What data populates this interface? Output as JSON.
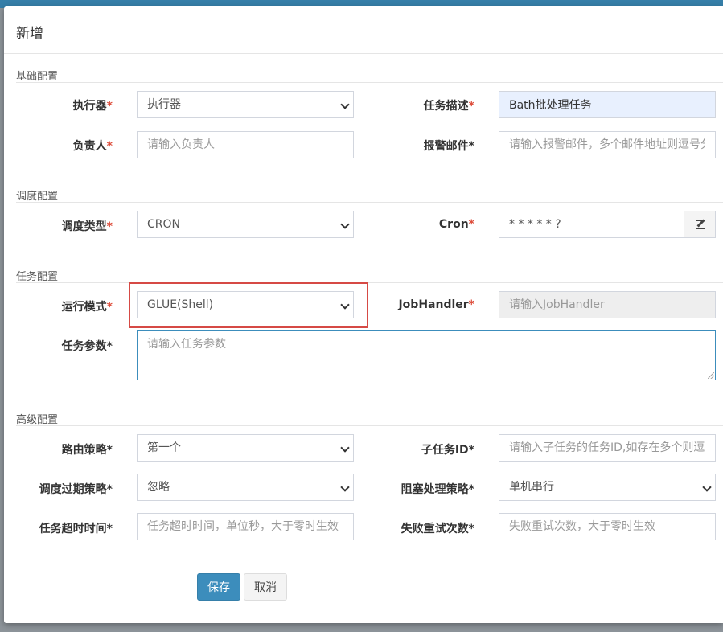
{
  "dialog": {
    "title": "新增"
  },
  "sections": {
    "basic": "基础配置",
    "schedule": "调度配置",
    "task": "任务配置",
    "advanced": "高级配置"
  },
  "required_mark": "*",
  "fields": {
    "executor": {
      "label": "执行器",
      "value": "执行器"
    },
    "job_desc": {
      "label": "任务描述",
      "value": "Bath批处理任务"
    },
    "author": {
      "label": "负责人",
      "placeholder": "请输入负责人"
    },
    "alarm_email": {
      "label": "报警邮件*",
      "placeholder": "请输入报警邮件，多个邮件地址则逗号分隔"
    },
    "schedule_type": {
      "label": "调度类型",
      "value": "CRON"
    },
    "cron": {
      "label": "Cron",
      "value": "* * * * * ?",
      "edit_icon": "edit-icon"
    },
    "run_mode": {
      "label": "运行模式",
      "value": "GLUE(Shell)"
    },
    "job_handler": {
      "label": "JobHandler",
      "placeholder": "请输入JobHandler"
    },
    "job_param": {
      "label": "任务参数*",
      "placeholder": "请输入任务参数"
    },
    "route_strategy": {
      "label": "路由策略*",
      "value": "第一个"
    },
    "child_job": {
      "label": "子任务ID*",
      "placeholder": "请输入子任务的任务ID,如存在多个则逗号分隔"
    },
    "misfire_strategy": {
      "label": "调度过期策略*",
      "value": "忽略"
    },
    "block_strategy": {
      "label": "阻塞处理策略*",
      "value": "单机串行"
    },
    "timeout": {
      "label": "任务超时时间*",
      "placeholder": "任务超时时间，单位秒，大于零时生效"
    },
    "fail_retry": {
      "label": "失败重试次数*",
      "placeholder": "失败重试次数，大于零时生效"
    }
  },
  "buttons": {
    "save": "保存",
    "cancel": "取消"
  },
  "colors": {
    "primary": "#3c8dbc",
    "required": "#dd4b39",
    "highlight": "#d64a45"
  }
}
